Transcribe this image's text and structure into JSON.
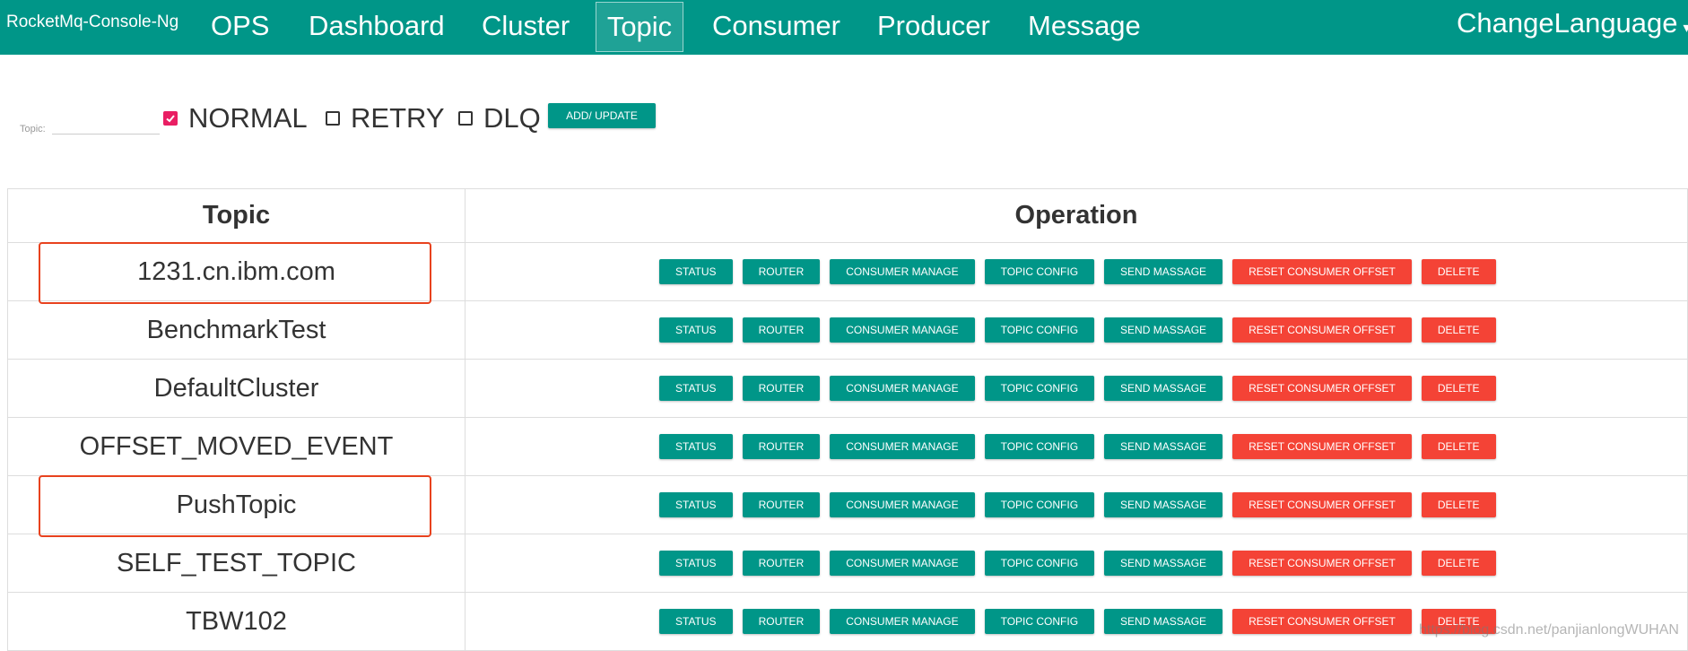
{
  "nav": {
    "brand": "RocketMq-Console-Ng",
    "items": [
      "OPS",
      "Dashboard",
      "Cluster",
      "Topic",
      "Consumer",
      "Producer",
      "Message"
    ],
    "active": "Topic",
    "change_language": "ChangeLanguage"
  },
  "filter": {
    "topic_label": "Topic:",
    "topic_value": "",
    "checkboxes": [
      {
        "label": "NORMAL",
        "checked": true
      },
      {
        "label": "RETRY",
        "checked": false
      },
      {
        "label": "DLQ",
        "checked": false
      }
    ],
    "add_button": "ADD/ UPDATE"
  },
  "table": {
    "headers": [
      "Topic",
      "Operation"
    ],
    "operations": [
      {
        "label": "STATUS",
        "style": "primary"
      },
      {
        "label": "ROUTER",
        "style": "primary"
      },
      {
        "label": "CONSUMER MANAGE",
        "style": "primary"
      },
      {
        "label": "TOPIC CONFIG",
        "style": "primary"
      },
      {
        "label": "SEND MASSAGE",
        "style": "primary"
      },
      {
        "label": "RESET CONSUMER OFFSET",
        "style": "danger"
      },
      {
        "label": "DELETE",
        "style": "danger"
      }
    ],
    "rows": [
      {
        "topic": "1231.cn.ibm.com",
        "highlighted": true
      },
      {
        "topic": "BenchmarkTest",
        "highlighted": false
      },
      {
        "topic": "DefaultCluster",
        "highlighted": false
      },
      {
        "topic": "OFFSET_MOVED_EVENT",
        "highlighted": false
      },
      {
        "topic": "PushTopic",
        "highlighted": true
      },
      {
        "topic": "SELF_TEST_TOPIC",
        "highlighted": false
      },
      {
        "topic": "TBW102",
        "highlighted": false
      }
    ]
  },
  "watermark": "https://blog.csdn.net/panjianlongWUHAN",
  "colors": {
    "primary": "#009688",
    "danger": "#f44336",
    "checkbox_checked": "#e91e63",
    "annotation": "#e8421e"
  }
}
